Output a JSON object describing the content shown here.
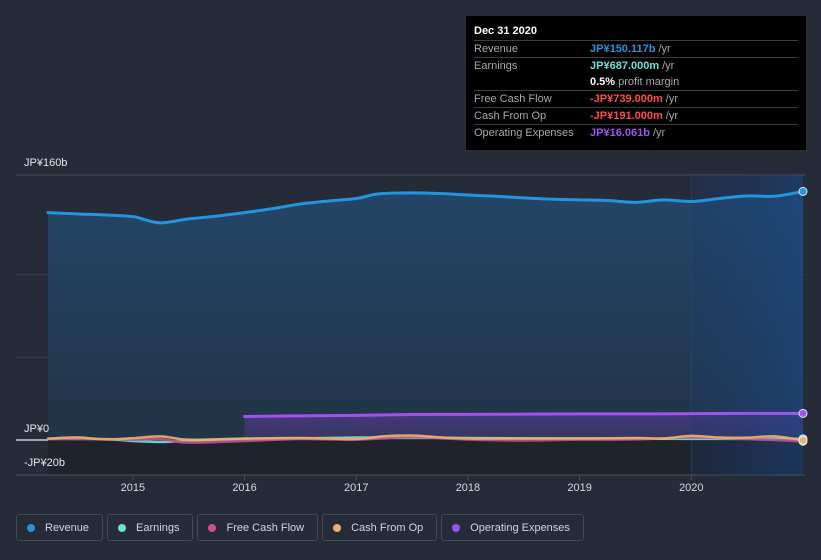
{
  "tooltip": {
    "date": "Dec 31 2020",
    "rows": [
      {
        "label": "Revenue",
        "value": "JP¥150.117b",
        "unit": "/yr",
        "color": "#2394df"
      },
      {
        "label": "Earnings",
        "value": "JP¥687.000m",
        "unit": "/yr",
        "color": "#6ce3d4"
      },
      {
        "label": "",
        "value": "0.5%",
        "unit": "profit margin",
        "color": "#ffffff"
      },
      {
        "label": "Free Cash Flow",
        "value": "-JP¥739.000m",
        "unit": "/yr",
        "color": "#ff4b4b"
      },
      {
        "label": "Cash From Op",
        "value": "-JP¥191.000m",
        "unit": "/yr",
        "color": "#ff4b4b"
      },
      {
        "label": "Operating Expenses",
        "value": "JP¥16.061b",
        "unit": "/yr",
        "color": "#a051ef"
      }
    ]
  },
  "legend": [
    {
      "label": "Revenue",
      "color": "#2394df"
    },
    {
      "label": "Earnings",
      "color": "#6ce3d4"
    },
    {
      "label": "Free Cash Flow",
      "color": "#c94e8a"
    },
    {
      "label": "Cash From Op",
      "color": "#e9b468"
    },
    {
      "label": "Operating Expenses",
      "color": "#a051ef"
    }
  ],
  "chart_data": {
    "type": "area",
    "title": "",
    "xlabel": "",
    "ylabel": "",
    "currency": "JP¥",
    "unit": "billions",
    "ylim": [
      -20,
      160
    ],
    "xlim": [
      2014.24,
      2021.0
    ],
    "y_tick_labels": [
      {
        "value": 160,
        "label": "JP¥160b"
      },
      {
        "value": 0,
        "label": "JP¥0"
      },
      {
        "value": -20,
        "label": "-JP¥20b"
      }
    ],
    "x_tick_labels": [
      "2015",
      "2016",
      "2017",
      "2018",
      "2019",
      "2020"
    ],
    "x_ticks": [
      2015,
      2016,
      2017,
      2018,
      2019,
      2020
    ],
    "highlight_start": 2020.0,
    "grid": true,
    "legend_position": "bottom-left",
    "series": [
      {
        "name": "Revenue",
        "color": "#2394df",
        "x": [
          2014.24,
          2014.5,
          2014.75,
          2015.0,
          2015.1,
          2015.25,
          2015.5,
          2015.75,
          2016.0,
          2016.25,
          2016.5,
          2016.75,
          2017.0,
          2017.2,
          2017.5,
          2017.75,
          2018.0,
          2018.25,
          2018.5,
          2018.75,
          2019.0,
          2019.25,
          2019.5,
          2019.75,
          2020.0,
          2020.25,
          2020.5,
          2020.75,
          2021.0
        ],
        "values": [
          137.3,
          136.5,
          135.9,
          134.9,
          133.2,
          131.1,
          133.5,
          135.2,
          137.3,
          139.7,
          142.5,
          144.3,
          145.8,
          148.6,
          149.2,
          148.8,
          147.9,
          147.2,
          146.2,
          145.4,
          145.0,
          144.6,
          143.5,
          145.0,
          144.0,
          145.8,
          147.4,
          147.2,
          150.1
        ]
      },
      {
        "name": "Operating Expenses",
        "color": "#a051ef",
        "x": [
          2016.0,
          2016.5,
          2017.0,
          2017.5,
          2018.0,
          2018.5,
          2019.0,
          2019.5,
          2020.0,
          2020.5,
          2021.0
        ],
        "values": [
          14.2,
          14.6,
          14.9,
          15.4,
          15.5,
          15.6,
          15.8,
          15.8,
          15.9,
          16.1,
          16.06
        ]
      },
      {
        "name": "Earnings",
        "color": "#6ce3d4",
        "x": [
          2014.24,
          2014.75,
          2015.0,
          2015.25,
          2015.5,
          2016.0,
          2016.5,
          2017.0,
          2017.5,
          2018.0,
          2018.5,
          2019.0,
          2019.5,
          2020.0,
          2020.5,
          2021.0
        ],
        "values": [
          0.8,
          0.5,
          -0.6,
          -1.2,
          -0.5,
          0.3,
          0.9,
          1.5,
          1.4,
          1.2,
          1.0,
          0.9,
          0.8,
          0.7,
          0.7,
          0.687
        ]
      },
      {
        "name": "Free Cash Flow",
        "color": "#c94e8a",
        "x": [
          2014.24,
          2014.75,
          2015.0,
          2015.25,
          2015.5,
          2016.0,
          2016.5,
          2017.0,
          2017.5,
          2018.0,
          2018.5,
          2019.0,
          2019.5,
          2020.0,
          2020.5,
          2021.0
        ],
        "values": [
          0.5,
          0.6,
          0.2,
          0.5,
          -1.6,
          -0.6,
          0.6,
          0.2,
          1.8,
          0.3,
          -0.3,
          0.2,
          0.4,
          1.5,
          0.6,
          -0.739
        ]
      },
      {
        "name": "Cash From Op",
        "color": "#e9b468",
        "x": [
          2014.24,
          2014.5,
          2014.75,
          2015.0,
          2015.25,
          2015.5,
          2016.0,
          2016.5,
          2017.0,
          2017.25,
          2017.5,
          2017.75,
          2018.0,
          2018.5,
          2019.0,
          2019.5,
          2019.75,
          2020.0,
          2020.25,
          2020.5,
          2020.75,
          2021.0
        ],
        "values": [
          0.8,
          1.6,
          0.4,
          1.1,
          2.2,
          0.2,
          0.9,
          1.2,
          0.6,
          2.3,
          2.7,
          1.6,
          0.9,
          0.9,
          0.9,
          1.2,
          0.9,
          2.5,
          1.5,
          1.4,
          2.2,
          -0.191
        ]
      }
    ]
  }
}
